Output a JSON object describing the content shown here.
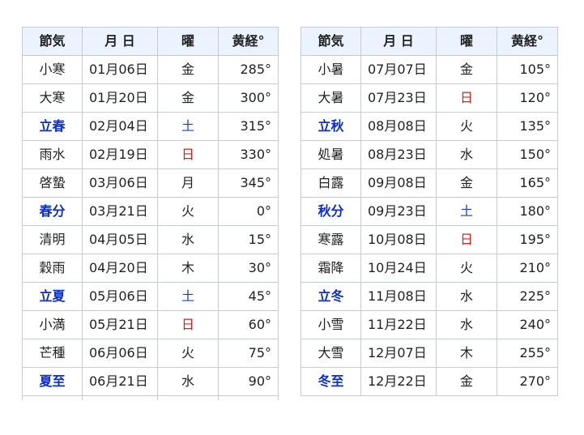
{
  "headers": {
    "name": "節気",
    "date": "月 日",
    "weekday": "曜",
    "longitude": "黄経°"
  },
  "colors": {
    "major_term": "#0b2fcf",
    "saturday": "#1f3dd6",
    "sunday": "#e01c1c",
    "header_bg": "#eaf3ff",
    "border": "#c8ccd1"
  },
  "left": [
    {
      "name": "小寒",
      "date": "01月06日",
      "weekday": "金",
      "deg": "285°",
      "major": false,
      "day_type": "weekday"
    },
    {
      "name": "大寒",
      "date": "01月20日",
      "weekday": "金",
      "deg": "300°",
      "major": false,
      "day_type": "weekday"
    },
    {
      "name": "立春",
      "date": "02月04日",
      "weekday": "土",
      "deg": "315°",
      "major": true,
      "day_type": "sat"
    },
    {
      "name": "雨水",
      "date": "02月19日",
      "weekday": "日",
      "deg": "330°",
      "major": false,
      "day_type": "sun"
    },
    {
      "name": "啓蟄",
      "date": "03月06日",
      "weekday": "月",
      "deg": "345°",
      "major": false,
      "day_type": "weekday"
    },
    {
      "name": "春分",
      "date": "03月21日",
      "weekday": "火",
      "deg": "0°",
      "major": true,
      "day_type": "weekday"
    },
    {
      "name": "清明",
      "date": "04月05日",
      "weekday": "水",
      "deg": "15°",
      "major": false,
      "day_type": "weekday"
    },
    {
      "name": "穀雨",
      "date": "04月20日",
      "weekday": "木",
      "deg": "30°",
      "major": false,
      "day_type": "weekday"
    },
    {
      "name": "立夏",
      "date": "05月06日",
      "weekday": "土",
      "deg": "45°",
      "major": true,
      "day_type": "sat"
    },
    {
      "name": "小満",
      "date": "05月21日",
      "weekday": "日",
      "deg": "60°",
      "major": false,
      "day_type": "sun"
    },
    {
      "name": "芒種",
      "date": "06月06日",
      "weekday": "火",
      "deg": "75°",
      "major": false,
      "day_type": "weekday"
    },
    {
      "name": "夏至",
      "date": "06月21日",
      "weekday": "水",
      "deg": "90°",
      "major": true,
      "day_type": "weekday"
    }
  ],
  "right": [
    {
      "name": "小暑",
      "date": "07月07日",
      "weekday": "金",
      "deg": "105°",
      "major": false,
      "day_type": "weekday"
    },
    {
      "name": "大暑",
      "date": "07月23日",
      "weekday": "日",
      "deg": "120°",
      "major": false,
      "day_type": "sun"
    },
    {
      "name": "立秋",
      "date": "08月08日",
      "weekday": "火",
      "deg": "135°",
      "major": true,
      "day_type": "weekday"
    },
    {
      "name": "処暑",
      "date": "08月23日",
      "weekday": "水",
      "deg": "150°",
      "major": false,
      "day_type": "weekday"
    },
    {
      "name": "白露",
      "date": "09月08日",
      "weekday": "金",
      "deg": "165°",
      "major": false,
      "day_type": "weekday"
    },
    {
      "name": "秋分",
      "date": "09月23日",
      "weekday": "土",
      "deg": "180°",
      "major": true,
      "day_type": "sat"
    },
    {
      "name": "寒露",
      "date": "10月08日",
      "weekday": "日",
      "deg": "195°",
      "major": false,
      "day_type": "sun"
    },
    {
      "name": "霜降",
      "date": "10月24日",
      "weekday": "火",
      "deg": "210°",
      "major": false,
      "day_type": "weekday"
    },
    {
      "name": "立冬",
      "date": "11月08日",
      "weekday": "水",
      "deg": "225°",
      "major": true,
      "day_type": "weekday"
    },
    {
      "name": "小雪",
      "date": "11月22日",
      "weekday": "水",
      "deg": "240°",
      "major": false,
      "day_type": "weekday"
    },
    {
      "name": "大雪",
      "date": "12月07日",
      "weekday": "木",
      "deg": "255°",
      "major": false,
      "day_type": "weekday"
    },
    {
      "name": "冬至",
      "date": "12月22日",
      "weekday": "金",
      "deg": "270°",
      "major": true,
      "day_type": "weekday"
    }
  ]
}
